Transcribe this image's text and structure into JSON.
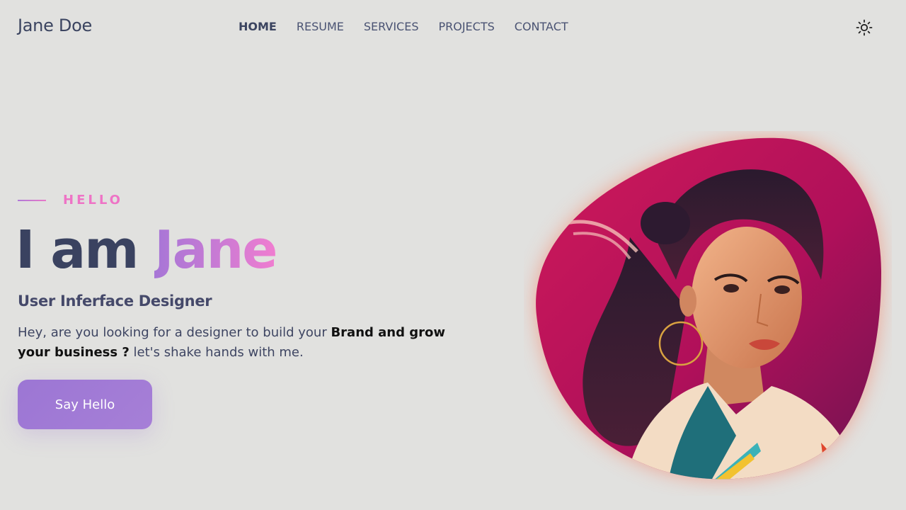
{
  "brand": "Jane Doe",
  "nav": {
    "items": [
      {
        "label": "HOME",
        "active": true
      },
      {
        "label": "RESUME",
        "active": false
      },
      {
        "label": "SERVICES",
        "active": false
      },
      {
        "label": "PROJECTS",
        "active": false
      },
      {
        "label": "CONTACT",
        "active": false
      }
    ],
    "theme_icon": "sun-icon"
  },
  "hero": {
    "eyebrow": "HELLO",
    "headline_prefix": "I am ",
    "headline_name": "Jane",
    "role": "User Inferface Designer",
    "desc_part1": "Hey, are you looking for a designer to build your ",
    "desc_bold": "Brand and grow your business ?",
    "desc_part2": " let's shake hands with me.",
    "cta_label": "Say Hello"
  },
  "portrait": {
    "alt": "illustrated portrait of a woman",
    "icon": "portrait-image"
  },
  "colors": {
    "background": "#e1e1df",
    "accent_purple": "#a776d6",
    "accent_pink": "#f07dd0",
    "text_dark": "#3a4260",
    "blob_red": "#c8124f",
    "blob_glow": "#f39a86"
  }
}
